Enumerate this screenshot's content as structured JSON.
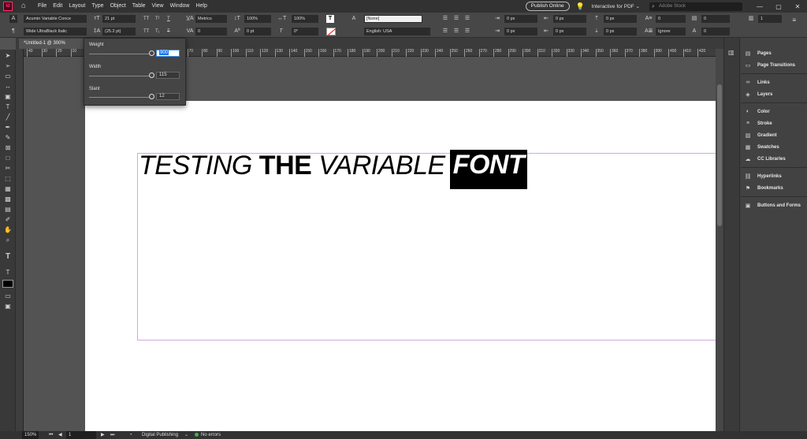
{
  "app": {
    "logo_text": "Id",
    "menu": [
      "File",
      "Edit",
      "Layout",
      "Type",
      "Object",
      "Table",
      "View",
      "Window",
      "Help"
    ],
    "publish_label": "Publish Online",
    "workspace_label": "Interactive for PDF ⌄",
    "stock_search_placeholder": "Adobe Stock"
  },
  "control": {
    "font_family": "Acumin Variable Conce",
    "font_style": "Wide UltraBlack Italic",
    "font_size": "21 pt",
    "leading": "(25.2 pt)",
    "kerning": "Metrics",
    "tracking": "0",
    "vertical_scale": "100%",
    "horizontal_scale": "100%",
    "baseline_shift": "0 pt",
    "skew": "0°",
    "character_style": "[None]",
    "language": "English: USA",
    "indent_left": "0 px",
    "indent_first": "0 px",
    "indent_right": "0 px",
    "indent_last": "0 px",
    "space_before": "0 px",
    "space_after": "0 px",
    "drop_cap_lines": "0",
    "drop_cap_chars": "0",
    "shading": "0",
    "columns": "1",
    "hyphenate": "Ignore",
    "small_caps_labels": [
      "TT",
      "T¹",
      "T",
      "T₁"
    ],
    "underline_labels": [
      "TT",
      "T₁",
      "T",
      "F"
    ]
  },
  "document": {
    "tab_title": "*Untitled-1 @ 300%",
    "ruler_ticks": [
      "40",
      "30",
      "20",
      "10",
      "0",
      "10",
      "20",
      "30",
      "40",
      "50",
      "60",
      "70",
      "80",
      "90",
      "100",
      "110",
      "120",
      "130",
      "140",
      "150",
      "160",
      "170",
      "180",
      "190",
      "200",
      "210",
      "220",
      "230",
      "240",
      "250",
      "260",
      "270",
      "280",
      "290",
      "300",
      "310",
      "320",
      "330",
      "340",
      "350",
      "360",
      "370",
      "380",
      "390",
      "400",
      "410",
      "420"
    ],
    "headline_part1": "TESTING ",
    "headline_part2": "THE",
    "headline_part3": " VARIABLE",
    "headline_part4": "FONT"
  },
  "variable_font": {
    "weight_label": "Weight",
    "weight_value": "900",
    "weight_pct": 0.98,
    "width_label": "Width",
    "width_value": "115",
    "width_pct": 0.98,
    "slant_label": "Slant",
    "slant_value": "12",
    "slant_pct": 0.98
  },
  "panels": {
    "group1": [
      "Pages",
      "Page Transitions"
    ],
    "group2": [
      "Links",
      "Layers"
    ],
    "group3": [
      "Color",
      "Stroke",
      "Gradient",
      "Swatches",
      "CC Libraries"
    ],
    "group4": [
      "Hyperlinks",
      "Bookmarks"
    ],
    "group5": [
      "Buttons and Forms"
    ]
  },
  "status": {
    "zoom": "150%",
    "page": "1",
    "mode": "Digital Publishing",
    "preflight": "No errors"
  }
}
